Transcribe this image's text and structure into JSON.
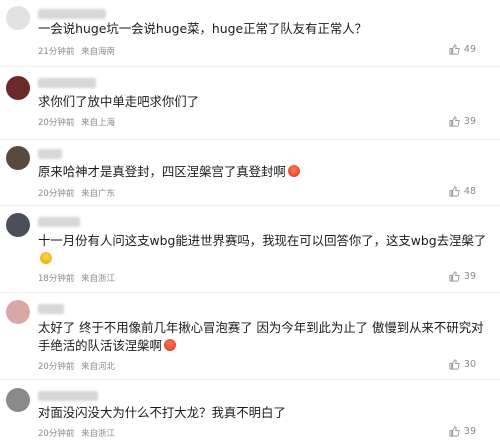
{
  "comments": [
    {
      "text": "一会说huge坑一会说huge菜，huge正常了队友有正常人？",
      "time": "21分钟前",
      "location": "来自海南",
      "likes": "49",
      "avatar_color": "#e2e2e2",
      "emoji": ""
    },
    {
      "text": "求你们了放中单走吧求你们了",
      "time": "20分钟前",
      "location": "来自上海",
      "likes": "39",
      "avatar_color": "#6b2a2a",
      "emoji": ""
    },
    {
      "text": "原来哈神才是真登封，四区涅槃宫了真登封啊",
      "time": "20分钟前",
      "location": "来自广东",
      "likes": "48",
      "avatar_color": "#5a4a3c",
      "emoji": "face-emoji-red"
    },
    {
      "text": "十一月份有人问这支wbg能进世界赛吗，我现在可以回答你了，这支wbg去涅槃了",
      "time": "18分钟前",
      "location": "来自浙江",
      "likes": "39",
      "avatar_color": "#4a4f5a",
      "emoji": "face-emoji-yellow"
    },
    {
      "text": "太好了 终于不用像前几年揪心冒泡赛了 因为今年到此为止了 傲慢到从来不研究对手绝活的队活该涅槃啊",
      "time": "20分钟前",
      "location": "来自河北",
      "likes": "30",
      "avatar_color": "#d9a7a7",
      "emoji": "face-emoji-red"
    },
    {
      "text": "对面没闪没大为什么不打大龙？我真不明白了",
      "time": "20分钟前",
      "location": "来自浙江",
      "likes": "39",
      "avatar_color": "#8a8a8a",
      "emoji": ""
    }
  ]
}
